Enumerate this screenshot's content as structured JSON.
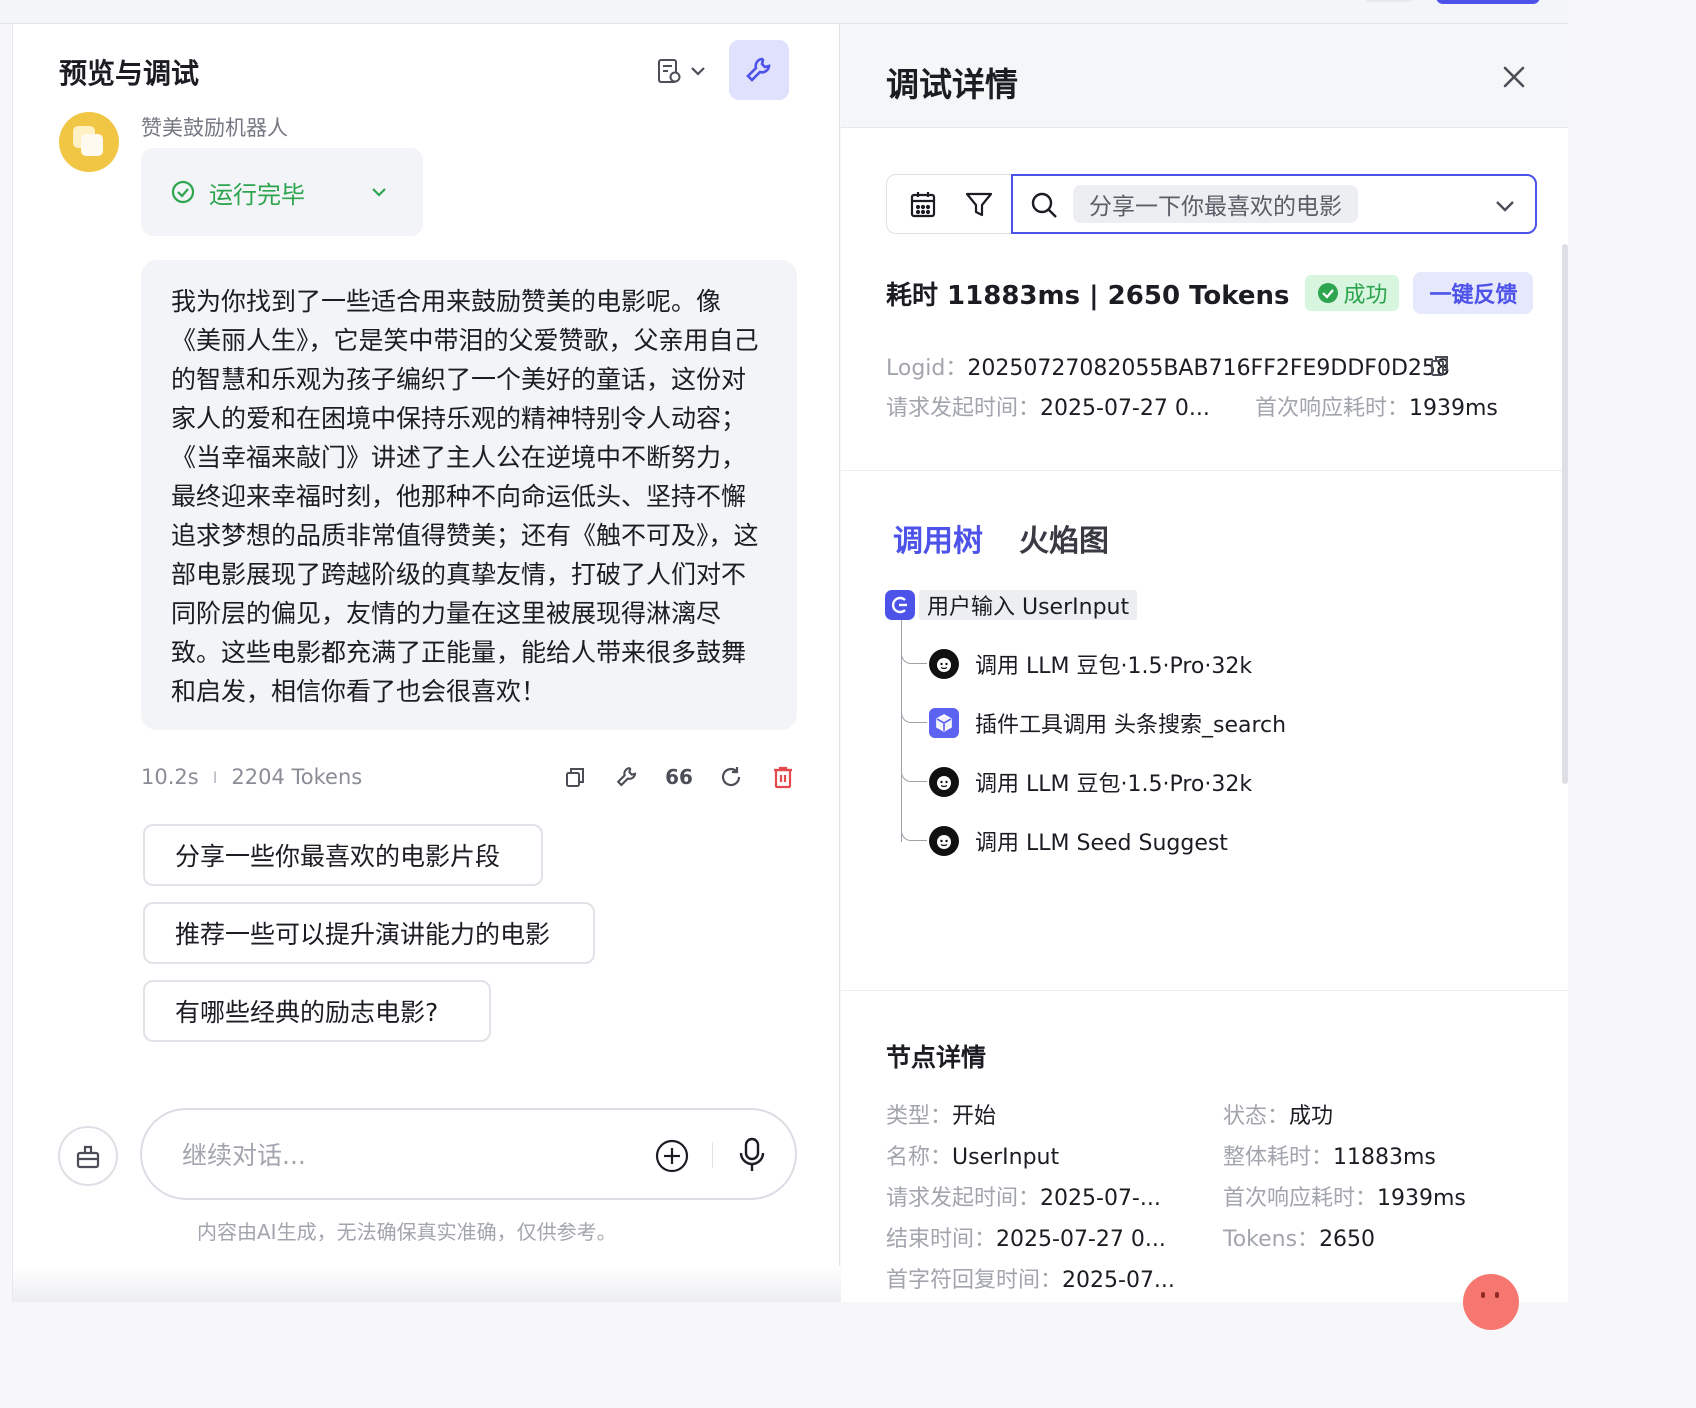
{
  "left_panel": {
    "title": "预览与调试",
    "bot_name": "赞美鼓励机器人",
    "run_status": "运行完毕",
    "message": "我为你找到了一些适合用来鼓励赞美的电影呢。像《美丽人生》，它是笑中带泪的父爱赞歌，父亲用自己的智慧和乐观为孩子编织了一个美好的童话，这份对家人的爱和在困境中保持乐观的精神特别令人动容；《当幸福来敲门》讲述了主人公在逆境中不断努力，最终迎来幸福时刻，他那种不向命运低头、坚持不懈追求梦想的品质非常值得赞美；还有《触不可及》，这部电影展现了跨越阶级的真挚友情，打破了人们对不同阶层的偏见，友情的力量在这里被展现得淋漓尽致。这些电影都充满了正能量，能给人带来很多鼓舞和启发，相信你看了也会很喜欢！",
    "duration": "10.2s",
    "tokens": "2204 Tokens",
    "quote_glyph": "66",
    "suggestions": [
      "分享一些你最喜欢的电影片段",
      "推荐一些可以提升演讲能力的电影",
      "有哪些经典的励志电影?"
    ],
    "input_placeholder": "继续对话...",
    "disclaimer": "内容由AI生成，无法确保真实准确，仅供参考。"
  },
  "right_panel": {
    "title": "调试详情",
    "search_query": "分享一下你最喜欢的电影",
    "summary": "耗时 11883ms | 2650 Tokens",
    "status_badge": "成功",
    "feedback_button": "一键反馈",
    "logid_label": "Logid：",
    "logid_value": "20250727082055BAB716FF2FE9DDF0D258",
    "request_time_label": "请求发起时间：",
    "request_time_value": "2025-07-27 0...",
    "first_response_label": "首次响应耗时：",
    "first_response_value": "1939ms",
    "tabs": [
      "调用树",
      "火焰图"
    ],
    "tree_root": "用户输入 UserInput",
    "tree_nodes": [
      "调用 LLM 豆包·1.5·Pro·32k",
      "插件工具调用 头条搜索_search",
      "调用 LLM 豆包·1.5·Pro·32k",
      "调用 LLM Seed Suggest"
    ],
    "node_details": {
      "title": "节点详情",
      "type_label": "类型：",
      "type_value": "开始",
      "status_label": "状态：",
      "status_value": "成功",
      "name_label": "名称：",
      "name_value": "UserInput",
      "total_label": "整体耗时：",
      "total_value": "11883ms",
      "req_label": "请求发起时间：",
      "req_value": "2025-07-...",
      "first_label": "首次响应耗时：",
      "first_value": "1939ms",
      "end_label": "结束时间：",
      "end_value": "2025-07-27 0...",
      "tokens_label": "Tokens：",
      "tokens_value": "2650",
      "first_char_label": "首字符回复时间：",
      "first_char_value": "2025-07..."
    }
  },
  "colors": {
    "accent": "#4d53e8",
    "success": "#2da44e",
    "danger": "#e5484d"
  }
}
